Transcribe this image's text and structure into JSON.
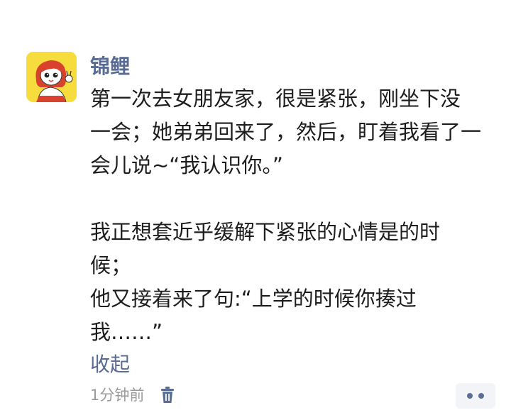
{
  "post": {
    "username": "锦鲤",
    "lines": [
      "第一次去女朋友家，很是紧张，刚坐下没",
      "一会；她弟弟回来了，然后，盯着我看了一",
      "会儿说~“我认识你。”"
    ],
    "lines2": [
      "我正想套近乎缓解下紧张的心情是的时",
      "候；",
      "他又接着来了句:“上学的时候你揍过",
      "我……”"
    ],
    "collapse_label": "收起",
    "time": "1分钟前"
  },
  "icons": {
    "avatar": "cartoon-girl-avatar",
    "delete": "trash-icon",
    "more": "more-dots-icon"
  },
  "colors": {
    "link": "#586b94",
    "meta": "#9a9a9a",
    "avatar_bg": "#f6dc3c"
  }
}
